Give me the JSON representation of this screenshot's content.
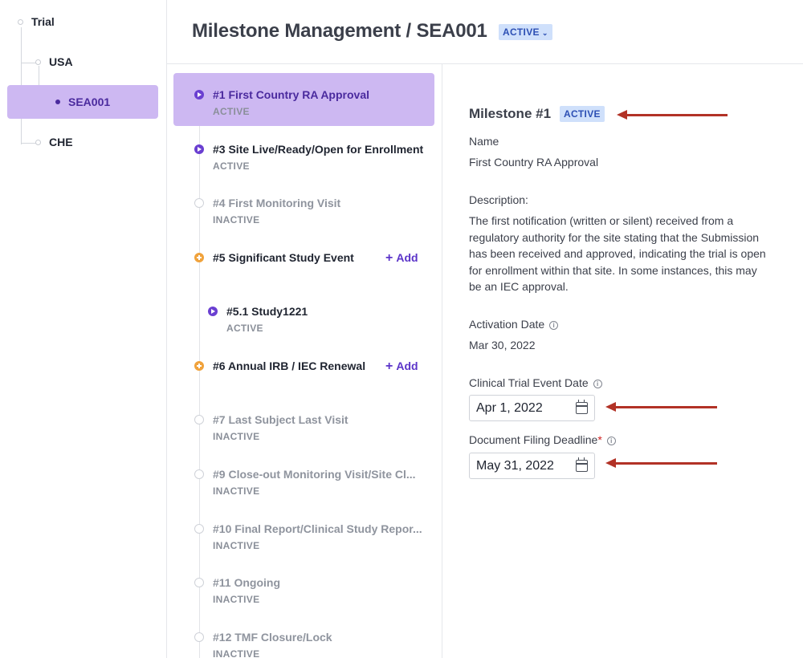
{
  "tree": {
    "nodes": [
      {
        "label": "Trial"
      },
      {
        "label": "USA"
      },
      {
        "label": "SEA001"
      },
      {
        "label": "CHE"
      }
    ]
  },
  "header": {
    "title": "Milestone Management / SEA001",
    "status": "ACTIVE"
  },
  "milestones": [
    {
      "title": "#1 First Country RA Approval",
      "status": "ACTIVE"
    },
    {
      "title": "#3 Site Live/Ready/Open for Enrollment",
      "status": "ACTIVE"
    },
    {
      "title": "#4 First Monitoring Visit",
      "status": "INACTIVE"
    },
    {
      "title": "#5 Significant Study Event",
      "add_label": "Add"
    },
    {
      "title": "#5.1 Study1221",
      "status": "ACTIVE"
    },
    {
      "title": "#6 Annual IRB / IEC Renewal",
      "add_label": "Add"
    },
    {
      "title": "#7 Last Subject Last Visit",
      "status": "INACTIVE"
    },
    {
      "title": "#9 Close-out Monitoring Visit/Site Cl...",
      "status": "INACTIVE"
    },
    {
      "title": "#10 Final Report/Clinical Study Repor...",
      "status": "INACTIVE"
    },
    {
      "title": "#11 Ongoing",
      "status": "INACTIVE"
    },
    {
      "title": "#12 TMF Closure/Lock",
      "status": "INACTIVE"
    }
  ],
  "detail": {
    "heading": "Milestone #1",
    "status": "ACTIVE",
    "name_label": "Name",
    "name_value": "First Country RA Approval",
    "description_label": "Description:",
    "description_value": "The first notification (written or silent) received from a regulatory authority for the site stating that the Submission has been received and approved, indicating the trial is open for enrollment within that site. In some instances, this may be an IEC approval.",
    "activation_label": "Activation Date",
    "activation_value": "Mar 30, 2022",
    "event_date_label": "Clinical Trial Event Date",
    "event_date_value": "Apr 1, 2022",
    "deadline_label": "Document Filing Deadline",
    "deadline_required_mark": "*",
    "deadline_value": "May 31, 2022"
  },
  "colors": {
    "selected_bg": "#cdb8f2",
    "accent": "#6a3fd1",
    "badge_bg": "#cfe0fb",
    "arrow": "#b23226",
    "add_icon": "#f0a23b"
  }
}
